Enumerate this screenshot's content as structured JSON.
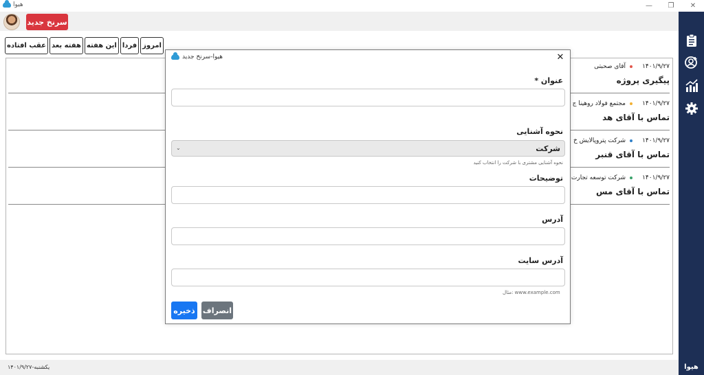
{
  "window": {
    "title": "هیوا"
  },
  "topbar": {
    "new_lead_label": "سرنخ جدید"
  },
  "filters": [
    {
      "label": "عقب افتاده"
    },
    {
      "label": "هفته بعد"
    },
    {
      "label": "این هفته"
    },
    {
      "label": "فردا"
    },
    {
      "label": "امروز"
    }
  ],
  "tasks": [
    {
      "date": "۱۴۰۱/۹/۲۷",
      "dot_color": "#e2574c",
      "who": "آقای صحبتی",
      "title": "پیگیری پروژه"
    },
    {
      "date": "۱۴۰۱/۹/۲۷",
      "dot_color": "#f2b134",
      "who": "مجتمع فولاد روهینا ج",
      "title": "تماس با آقای هد"
    },
    {
      "date": "۱۴۰۱/۹/۲۷",
      "dot_color": "#2f80c8",
      "who": "شرکت پتروپالایش خ",
      "title": "تماس با آقای قنبر"
    },
    {
      "date": "۱۴۰۱/۹/۲۷",
      "dot_color": "#3aa26a",
      "who": "شرکت توسعه تجارت",
      "title": "تماس با آقای مس"
    }
  ],
  "sidebar": {
    "icons": [
      "clipboard-icon",
      "add-user-icon",
      "chart-icon",
      "gear-icon"
    ],
    "brand": "هیوا"
  },
  "statusbar": {
    "text": "یکشنبه-۱۴۰۱/۹/۲۷"
  },
  "modal": {
    "title": "هیوا-سرنخ جدید",
    "fields": {
      "title_label": "عنوان *",
      "acquaintance_label": "نحوه آشنایی",
      "acquaintance_value": "شرکت",
      "acquaintance_hint": "نحوه آشنایی مشتری با شرکت را انتخاب کنید",
      "description_label": "توضیحات",
      "address_label": "آدرس",
      "website_label": "آدرس سایت",
      "website_hint": "مثال: www.example.com"
    },
    "save_label": "ذخیره",
    "cancel_label": "انصراف"
  }
}
